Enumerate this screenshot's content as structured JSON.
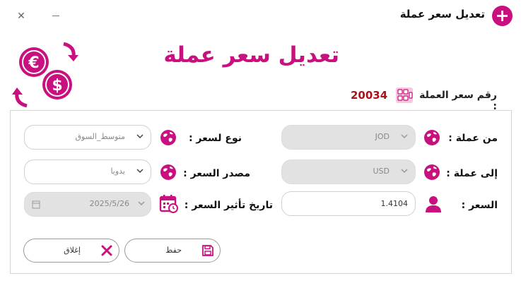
{
  "window": {
    "title": "تعديل سعر عملة"
  },
  "header": {
    "title": "تعديل سعر عملة"
  },
  "rate_number": {
    "label": "رقم سعر العملة :",
    "value": "20034"
  },
  "form": {
    "from_currency": {
      "label": "من عملة :",
      "value": "JOD"
    },
    "to_currency": {
      "label": "إلى عملة :",
      "value": "USD"
    },
    "price": {
      "label": "السعر :",
      "value": "1.4104"
    },
    "rate_type": {
      "label": "نوع لسعر :",
      "value": "متوسط_السوق"
    },
    "rate_source": {
      "label": "مصدر السعر :",
      "value": "يدويا"
    },
    "effective_date": {
      "label": "تاريخ تأثير السعر :",
      "value": "2025/5/26"
    }
  },
  "buttons": {
    "save": "حفظ",
    "close": "إغلاق"
  },
  "colors": {
    "accent": "#c8107e",
    "rate_number": "#b0101a",
    "disabled_field": "#e2e2e2"
  },
  "icons": {
    "app": "plus-circle-icon",
    "header": "currency-exchange-icon",
    "rate_number": "abacus-icon",
    "currency": "globe-icon",
    "price": "user-icon",
    "date": "calendar-icon",
    "save": "floppy-disk-icon",
    "close": "x-icon"
  }
}
